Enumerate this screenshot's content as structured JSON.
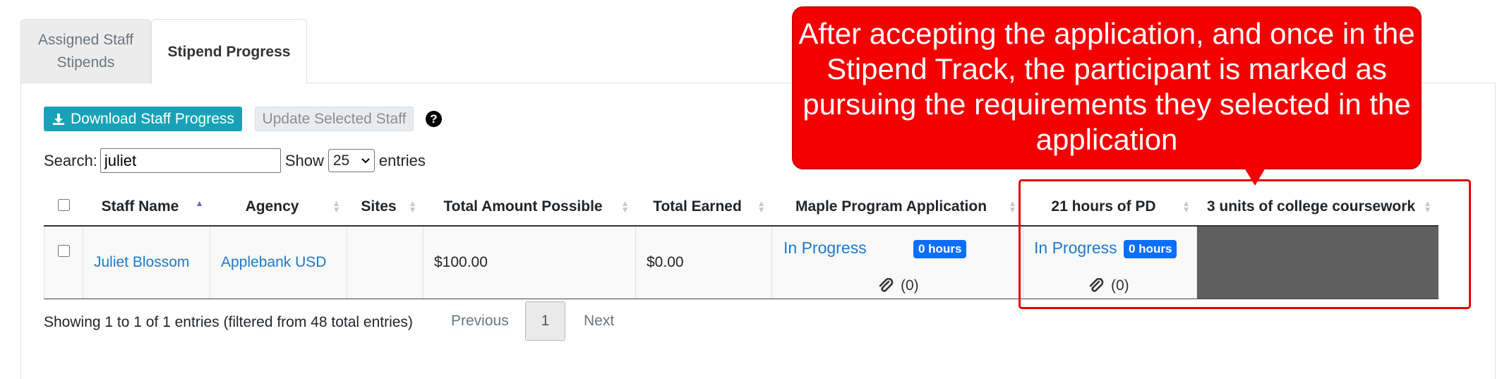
{
  "tabs": [
    {
      "label": "Assigned Staff Stipends",
      "active": false
    },
    {
      "label": "Stipend Progress",
      "active": true
    }
  ],
  "toolbar": {
    "download_label": "Download Staff Progress",
    "update_label": "Update Selected Staff",
    "help_icon": "question-circle-icon"
  },
  "search": {
    "label": "Search:",
    "value": "juliet",
    "show_label": "Show",
    "entries_value": "25",
    "entries_label": "entries"
  },
  "table": {
    "columns": [
      "Staff Name",
      "Agency",
      "Sites",
      "Total Amount Possible",
      "Total Earned",
      "Maple Program Application",
      "21 hours of PD",
      "3 units of college coursework"
    ],
    "sorted_column": "Staff Name",
    "rows": [
      {
        "staff_name": "Juliet Blossom",
        "agency": "Applebank USD",
        "sites": "",
        "total_possible": "$100.00",
        "total_earned": "$0.00",
        "maple_status": "In Progress",
        "maple_hours": "0 hours",
        "maple_attachments": "(0)",
        "pd_status": "In Progress",
        "pd_hours": "0 hours",
        "pd_attachments": "(0)"
      }
    ]
  },
  "footer": {
    "info": "Showing 1 to 1 of 1 entries (filtered from 48 total entries)",
    "previous": "Previous",
    "current_page": "1",
    "next": "Next"
  },
  "annotation": {
    "text": "After accepting the application, and once in the Stipend Track, the participant is marked as pursuing the requirements they selected in the application",
    "color": "#f40000"
  },
  "colors": {
    "download_button": "#17a2b8",
    "badge": "#0d6efd",
    "link": "#1f7ac9",
    "unselected_cell": "#5f5f5f"
  }
}
